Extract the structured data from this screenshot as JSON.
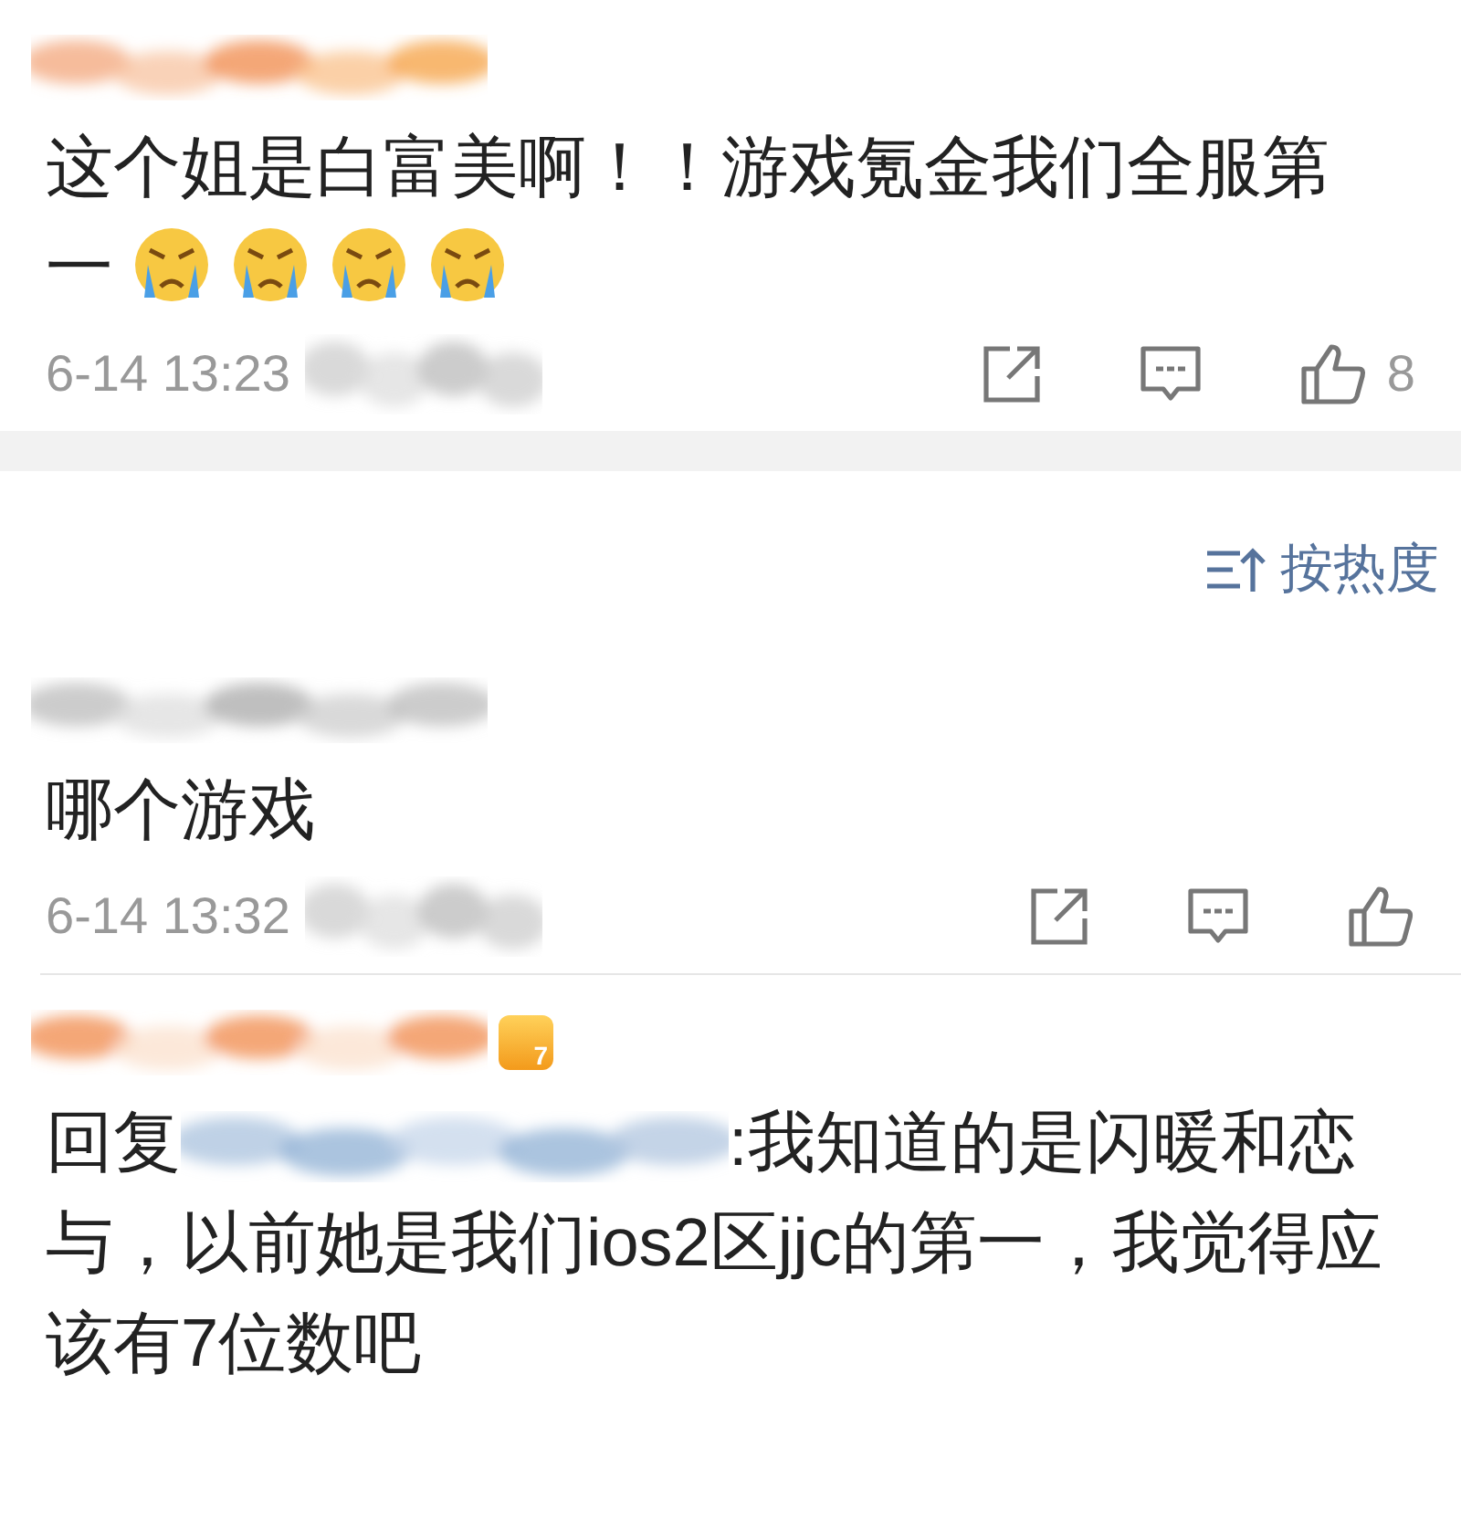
{
  "comments": [
    {
      "kind": "plain",
      "text": "这个姐是白富美啊！！游戏氪金我们全服第一",
      "emojis": [
        {
          "kind": "crying"
        },
        {
          "kind": "crying"
        },
        {
          "kind": "crying"
        },
        {
          "kind": "crying"
        }
      ],
      "time": "6-14 13:23",
      "likes": "8"
    },
    {
      "kind": "sort",
      "label": "按热度"
    },
    {
      "kind": "plain",
      "text": "哪个游戏",
      "time": "6-14 13:32"
    },
    {
      "kind": "reply",
      "reply_prefix": "回复",
      "text": ":我知道的是闪暖和恋与，以前她是我们ios2区jjc的第一，我觉得应该有7位数吧",
      "level_badge": "7"
    }
  ]
}
